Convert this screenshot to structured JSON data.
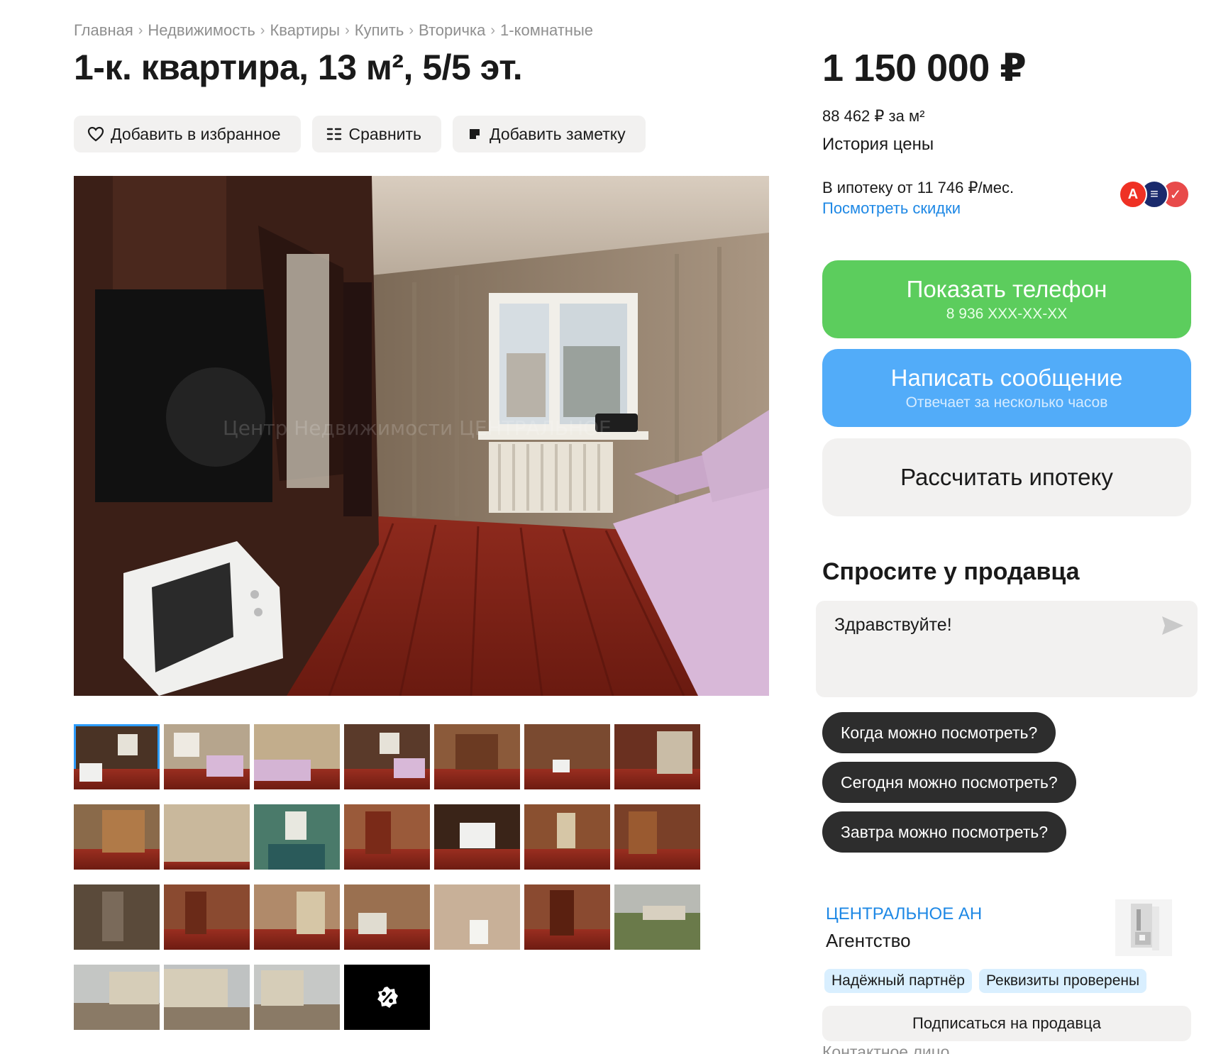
{
  "breadcrumb": [
    "Главная",
    "Недвижимость",
    "Квартиры",
    "Купить",
    "Вторичка",
    "1-комнатные"
  ],
  "title": "1-к. квартира, 13 м², 5/5 эт.",
  "actions": {
    "favorite": "Добавить в избранное",
    "compare": "Сравнить",
    "note": "Добавить заметку"
  },
  "gallery": {
    "watermark": "Центр Недвижимости ЦЕНТРАЛЬНОЕ",
    "thumbnails": [
      [
        "thumb-1",
        "thumb-2",
        "thumb-3",
        "thumb-4",
        "thumb-5",
        "thumb-6",
        "thumb-7"
      ],
      [
        "thumb-8",
        "thumb-9",
        "thumb-10",
        "thumb-11",
        "thumb-12",
        "thumb-13",
        "thumb-14"
      ],
      [
        "thumb-15",
        "thumb-16",
        "thumb-17",
        "thumb-18",
        "thumb-19",
        "thumb-20",
        "thumb-21"
      ],
      [
        "thumb-22",
        "thumb-23",
        "thumb-24"
      ]
    ],
    "more_icon": "percent-badge-icon"
  },
  "price": {
    "total": "1 150 000 ₽",
    "per_m2": "88 462 ₽ за м²",
    "history": "История цены"
  },
  "mortgage": {
    "text": "В ипотеку от 11 746 ₽/мес.",
    "link": "Посмотреть скидки",
    "banks": [
      "alfa-bank-logo",
      "bank-logo-blue",
      "bank-logo-red"
    ]
  },
  "buttons": {
    "phone_main": "Показать телефон",
    "phone_sub": "8 936 XXX-XX-XX",
    "message_main": "Написать сообщение",
    "message_sub": "Отвечает за несколько часов",
    "mortgage": "Рассчитать ипотеку"
  },
  "ask": {
    "title": "Спросите у продавца",
    "message": "Здравствуйте!",
    "chips": [
      "Когда можно посмотреть?",
      "Сегодня можно посмотреть?",
      "Завтра можно посмотреть?"
    ]
  },
  "seller": {
    "name": "ЦЕНТРАЛЬНОЕ АН",
    "type": "Агентство",
    "badges": [
      "Надёжный партнёр",
      "Реквизиты проверены"
    ],
    "subscribe": "Подписаться на продавца",
    "contact_label": "Контактное лицо"
  },
  "colors": {
    "green": "#5ccd5d",
    "blue": "#52acf9",
    "link": "#1e88e5",
    "chip": "#2d2d2d",
    "badge": "#d9efff"
  }
}
